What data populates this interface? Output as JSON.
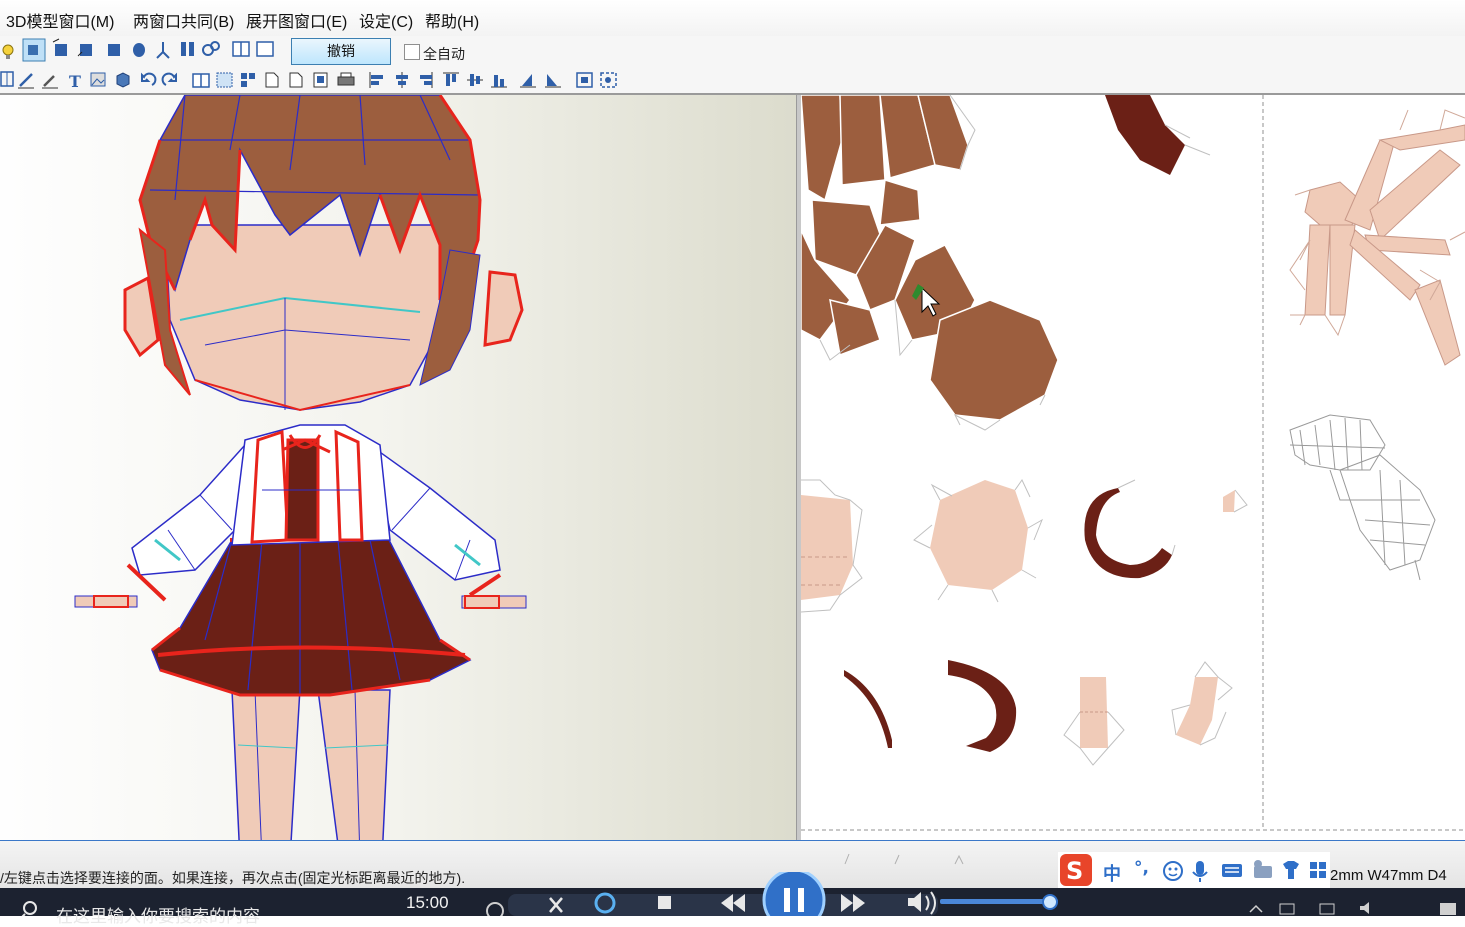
{
  "menu": [
    "3D模型窗口(M)",
    "两窗口共同(B)",
    "展开图窗口(E)",
    "设定(C)",
    "帮助(H)"
  ],
  "toolbar": {
    "undo_label": "撤销",
    "auto_label": "全自动",
    "auto_checked": false
  },
  "status": {
    "hint": "/左键点击选择要连接的面。如果连接，再次点击(固定光标距离最近的地方).",
    "size": "2mm W47mm D4"
  },
  "ime": {
    "lang": "中",
    "punct": "°,"
  },
  "taskbar": {
    "search_placeholder": "在这里输入你要搜索的内容",
    "time": "15:00"
  },
  "colors": {
    "hair": "#9c5e3e",
    "skin": "#f0cbb8",
    "skirt": "#6b2016",
    "edge_red": "#e8241c",
    "edge_blue": "#2c2cc8",
    "accent": "#3b78c8"
  }
}
